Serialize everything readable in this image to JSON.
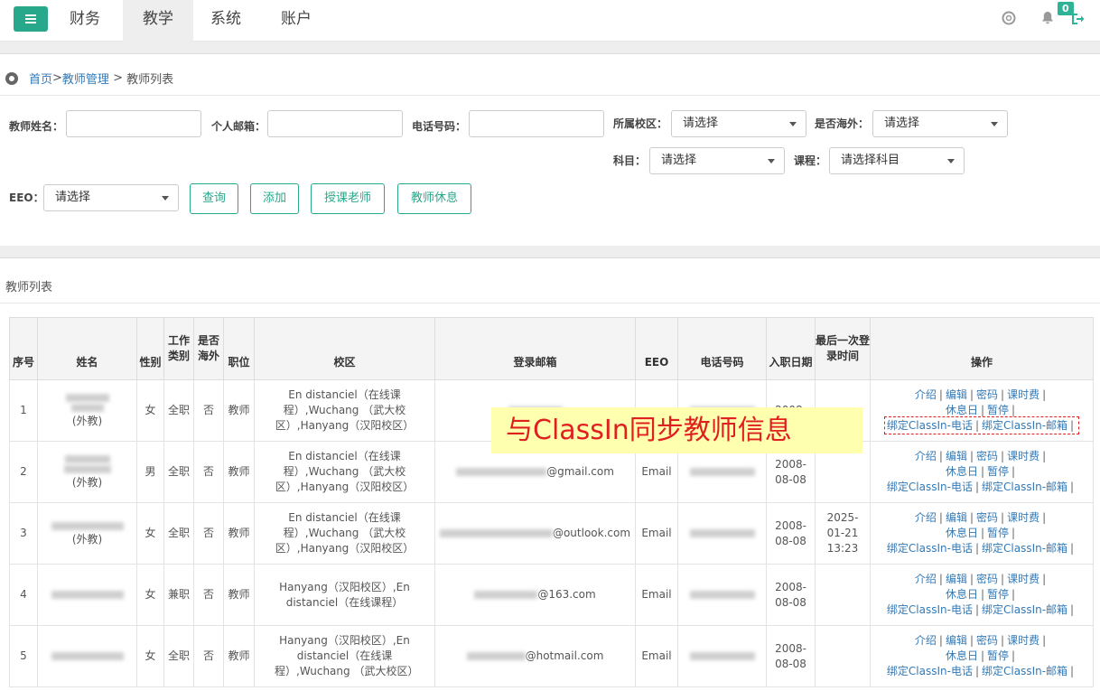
{
  "nav": {
    "menu_icon": "hamburger-icon",
    "tabs": [
      {
        "label": "财务"
      },
      {
        "label": "教学"
      },
      {
        "label": "系统"
      },
      {
        "label": "账户"
      }
    ],
    "notification_count": "0"
  },
  "breadcrumb": {
    "home": "首页",
    "sep1": " >",
    "teacher_mgmt": "教师管理",
    "sep2": " > ",
    "current": "教师列表"
  },
  "filters": {
    "name_label": "教师姓名：",
    "email_label": "个人邮箱：",
    "phone_label": "电话号码：",
    "campus_label": "所属校区：",
    "campus_value": "请选择",
    "overseas_label": "是否海外：",
    "overseas_value": "请选择",
    "subject_label": "科目：",
    "subject_value": "请选择",
    "course_label": "课程：",
    "course_value": "请选择科目",
    "eeo_label": "EEO：",
    "eeo_value": "请选择"
  },
  "buttons": {
    "query": "查询",
    "add": "添加",
    "teaching": "授课老师",
    "rest": "教师休息"
  },
  "section_title": "教师列表",
  "table": {
    "headers": {
      "no": "序号",
      "name": "姓名",
      "gender": "性别",
      "worktype": "工作类别",
      "overseas": "是否海外",
      "position": "职位",
      "campus": "校区",
      "email": "登录邮箱",
      "eeo": "EEO",
      "phone": "电话号码",
      "joindate": "入职日期",
      "lastlogin": "最后一次登录时间",
      "ops": "操作"
    },
    "ops": {
      "intro": "介绍",
      "edit": "编辑",
      "password": "密码",
      "fee": "课时费",
      "restday": "休息日",
      "pause": "暂停",
      "bind_phone": "绑定ClassIn-电话",
      "bind_email": "绑定ClassIn-邮箱"
    },
    "rows": [
      {
        "no": "1",
        "name_suffix": "(外教)",
        "gender": "女",
        "worktype": "全职",
        "overseas": "否",
        "position": "教师",
        "campus": "En distanciel（在线课程）,Wuchang （武大校区）,Hanyang（汉阳校区）",
        "email": "",
        "eeo": "",
        "joindate": "2008-",
        "lastlogin": ""
      },
      {
        "no": "2",
        "name_suffix": "(外教)",
        "gender": "男",
        "worktype": "全职",
        "overseas": "否",
        "position": "教师",
        "campus": "En distanciel（在线课程）,Wuchang （武大校区）,Hanyang（汉阳校区）",
        "email": "@gmail.com",
        "eeo": "Email",
        "joindate": "2008-08-08",
        "lastlogin": ""
      },
      {
        "no": "3",
        "name_suffix": "(外教)",
        "gender": "女",
        "worktype": "全职",
        "overseas": "否",
        "position": "教师",
        "campus": "En distanciel（在线课程）,Wuchang （武大校区）,Hanyang（汉阳校区）",
        "email": "@outlook.com",
        "eeo": "Email",
        "joindate": "2008-08-08",
        "lastlogin": "2025-01-21 13:23"
      },
      {
        "no": "4",
        "name_suffix": "",
        "gender": "女",
        "worktype": "兼职",
        "overseas": "否",
        "position": "教师",
        "campus": "Hanyang（汉阳校区）,En distanciel（在线课程）",
        "email": "@163.com",
        "eeo": "Email",
        "joindate": "2008-08-08",
        "lastlogin": ""
      },
      {
        "no": "5",
        "name_suffix": "",
        "gender": "女",
        "worktype": "全职",
        "overseas": "否",
        "position": "教师",
        "campus": "Hanyang（汉阳校区）,En distanciel（在线课程）,Wuchang （武大校区）",
        "email": "@hotmail.com",
        "eeo": "Email",
        "joindate": "2008-08-08",
        "lastlogin": ""
      }
    ]
  },
  "callout": "与ClassIn同步教师信息",
  "colors": {
    "accent": "#27a88a",
    "link": "#337ab7",
    "callout_bg": "#ffffb0",
    "callout_text": "#e02020"
  }
}
